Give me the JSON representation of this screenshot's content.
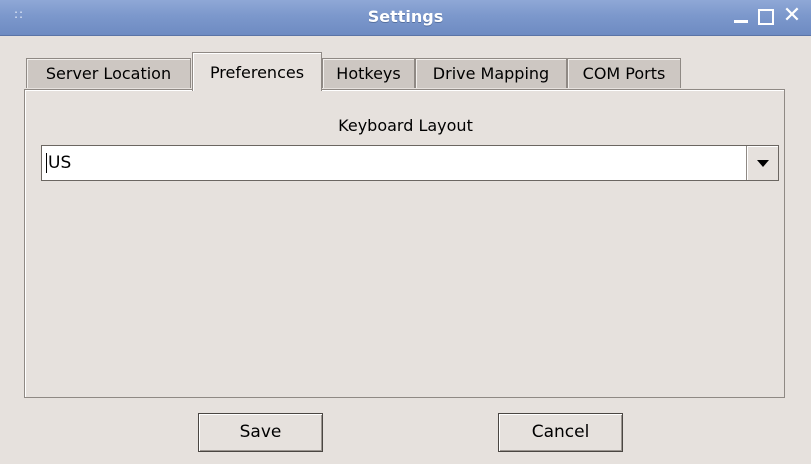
{
  "window": {
    "title": "Settings",
    "grip_glyph": "::",
    "close_glyph": "✕"
  },
  "tabs": [
    {
      "label": "Server Location",
      "active": false
    },
    {
      "label": "Preferences",
      "active": true
    },
    {
      "label": "Hotkeys",
      "active": false
    },
    {
      "label": "Drive Mapping",
      "active": false
    },
    {
      "label": "COM Ports",
      "active": false
    }
  ],
  "preferences": {
    "keyboard_layout_label": "Keyboard Layout",
    "keyboard_layout_value": "US"
  },
  "buttons": {
    "save": "Save",
    "cancel": "Cancel"
  },
  "colors": {
    "titlebar": "#7c98cc",
    "window_bg": "#e6e1dd",
    "inactive_tab": "#cdc7c2"
  },
  "icons": [
    "grip-icon",
    "minimize-icon",
    "maximize-icon",
    "close-icon",
    "chevron-down-icon"
  ]
}
